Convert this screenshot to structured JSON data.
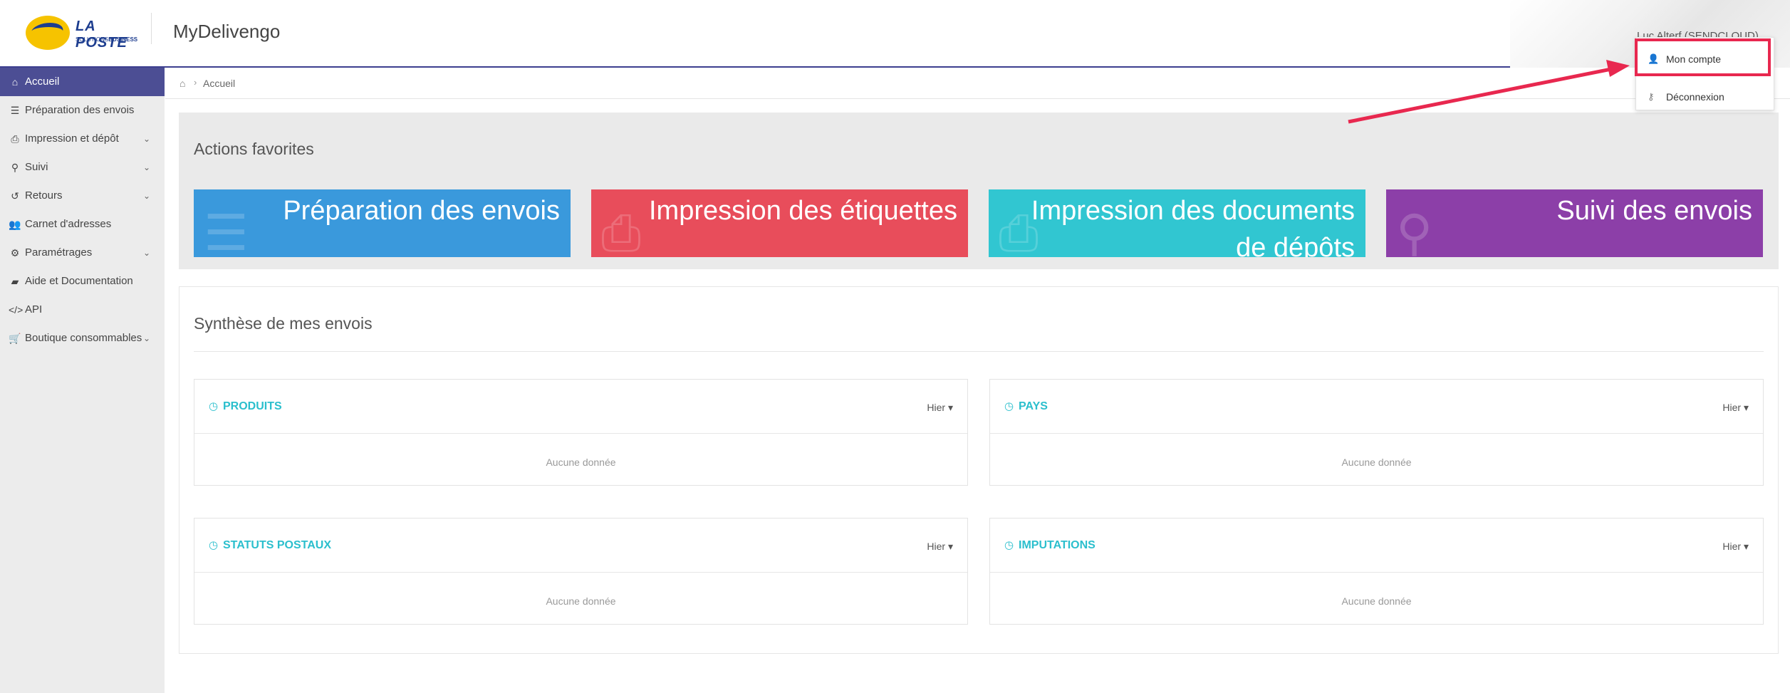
{
  "header": {
    "logo_name": "LA POSTE",
    "logo_sub_prefix": "SOLUTIONS",
    "logo_sub_strong": "BUSINESS",
    "app_title": "MyDelivengo",
    "user_name": "Luc Alterf (SENDCLOUD)"
  },
  "sidebar": {
    "items": [
      {
        "label": "Accueil",
        "icon": "home-icon",
        "active": true,
        "expandable": false
      },
      {
        "label": "Préparation des envois",
        "icon": "list-icon",
        "active": false,
        "expandable": false
      },
      {
        "label": "Impression et dépôt",
        "icon": "print-icon",
        "active": false,
        "expandable": true
      },
      {
        "label": "Suivi",
        "icon": "search-icon",
        "active": false,
        "expandable": true
      },
      {
        "label": "Retours",
        "icon": "undo-icon",
        "active": false,
        "expandable": true
      },
      {
        "label": "Carnet d'adresses",
        "icon": "users-icon",
        "active": false,
        "expandable": false
      },
      {
        "label": "Paramétrages",
        "icon": "gear-icon",
        "active": false,
        "expandable": true
      },
      {
        "label": "Aide et Documentation",
        "icon": "book-icon",
        "active": false,
        "expandable": false
      },
      {
        "label": "API",
        "icon": "code-icon",
        "active": false,
        "expandable": false
      },
      {
        "label": "Boutique consommables",
        "icon": "cart-icon",
        "active": false,
        "expandable": true
      }
    ]
  },
  "breadcrumb": {
    "current": "Accueil"
  },
  "favorites": {
    "title": "Actions favorites",
    "tiles": [
      {
        "label": "Préparation des envois",
        "color": "#3a99dc",
        "icon": "list-icon"
      },
      {
        "label": "Impression des étiquettes",
        "color": "#e84d5b",
        "icon": "print-icon"
      },
      {
        "label": "Impression des documents de dépôts",
        "color": "#31c6d1",
        "icon": "print-icon"
      },
      {
        "label": "Suivi des envois",
        "color": "#8c3fa8",
        "icon": "search-icon"
      }
    ]
  },
  "synthese": {
    "title": "Synthèse de mes envois",
    "cards": [
      {
        "title": "PRODUITS",
        "period": "Hier",
        "empty": "Aucune donnée"
      },
      {
        "title": "PAYS",
        "period": "Hier",
        "empty": "Aucune donnée"
      },
      {
        "title": "STATUTS POSTAUX",
        "period": "Hier",
        "empty": "Aucune donnée"
      },
      {
        "title": "IMPUTATIONS",
        "period": "Hier",
        "empty": "Aucune donnée"
      }
    ]
  },
  "user_menu": {
    "account": "Mon compte",
    "logout": "Déconnexion"
  },
  "colors": {
    "accent": "#4c4e94",
    "card_title": "#2bbfcd",
    "annotation": "#e8284f"
  }
}
